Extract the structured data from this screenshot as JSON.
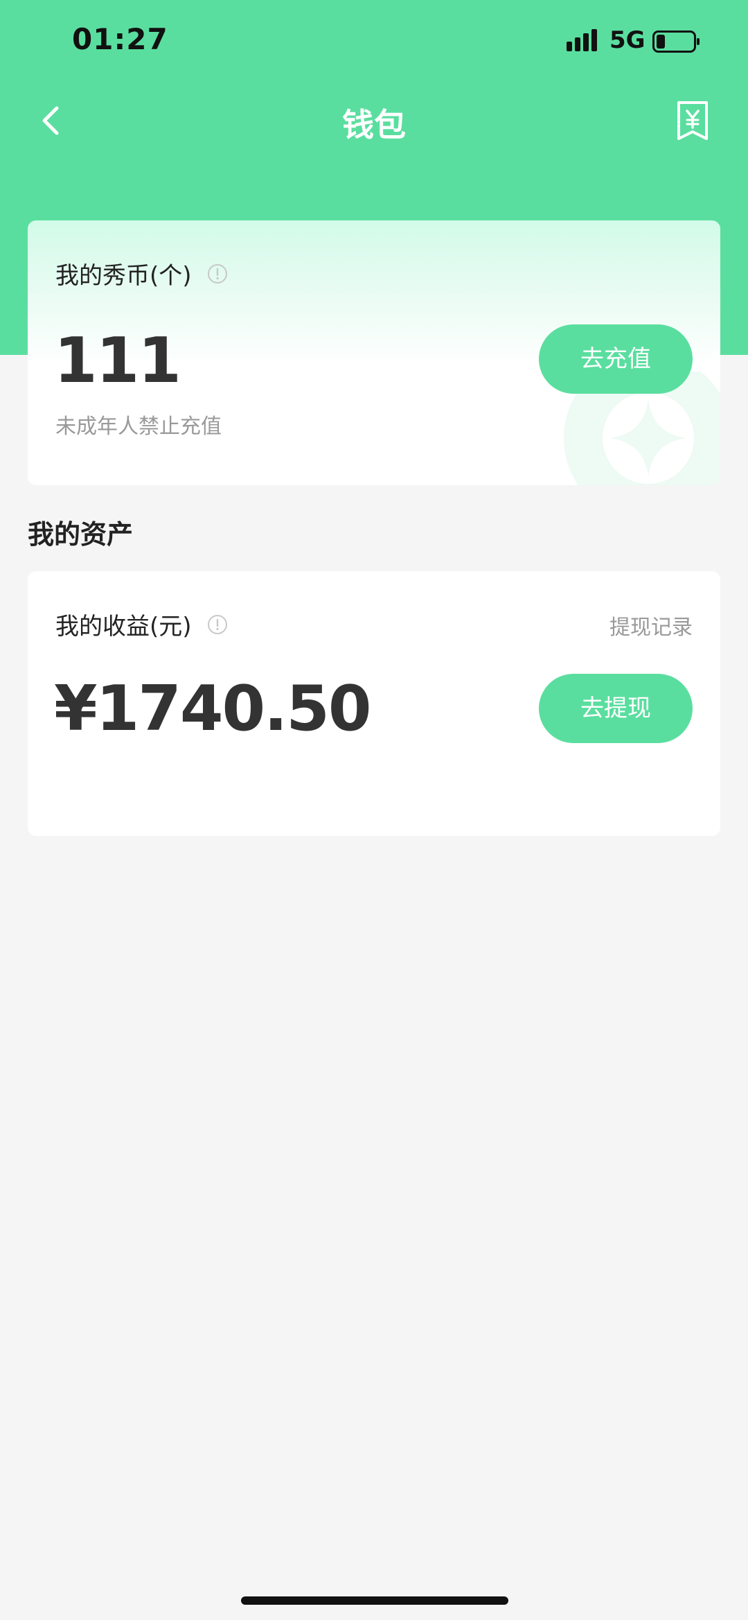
{
  "status_bar": {
    "time": "01:27",
    "network": "5G",
    "signal_icon": "signal-bars-icon",
    "battery_icon": "battery-low-icon"
  },
  "nav": {
    "title": "钱包",
    "back_icon": "chevron-left-icon",
    "bill_icon": "receipt-yuan-icon"
  },
  "coins": {
    "label": "我的秀币(个)",
    "info_icon": "info-circle-icon",
    "amount": "111",
    "note": "未成年人禁止充值",
    "recharge_label": "去充值",
    "watermark_icon": "coin-sparkle-icon"
  },
  "assets": {
    "section_title": "我的资产",
    "earnings": {
      "label": "我的收益(元)",
      "info_icon": "info-circle-icon",
      "record_link": "提现记录",
      "amount": "¥1740.50",
      "withdraw_label": "去提现"
    }
  },
  "colors": {
    "accent": "#5ade9f",
    "background": "#f5f5f5",
    "card": "#ffffff",
    "muted_text": "#999999"
  }
}
